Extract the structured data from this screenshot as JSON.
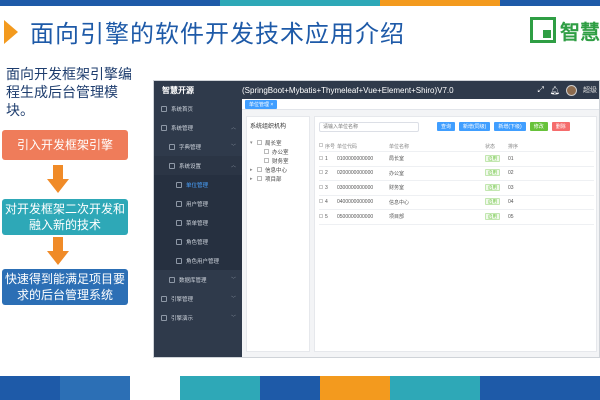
{
  "slide": {
    "title": "面向引擎的软件开发技术应用介绍",
    "logo_text": "智慧",
    "intro": "面向开发框架引擎编程生成后台管理模块。",
    "flow": [
      "引入开发框架引擎",
      "对开发框架二次开发和融入新的技术",
      "快速得到能满足项目要求的后台管理系统"
    ],
    "colors": {
      "title": "#1e5aa8",
      "accent_orange": "#f39a1e",
      "box1": "#ef7c5a",
      "box2": "#2ea8b7",
      "box3": "#2c6fb5",
      "logo_green": "#2f9e44"
    }
  },
  "app": {
    "brand": "智慧开源",
    "title": "(SpringBoot+Mybatis+Thymeleaf+Vue+Element+Shiro)V7.0",
    "header_icons": [
      "expand-icon",
      "bell-icon"
    ],
    "user_label": "超级",
    "sidebar": [
      {
        "label": "系统首页",
        "level": 1,
        "expandable": false
      },
      {
        "label": "系统管理",
        "level": 1,
        "expandable": true
      },
      {
        "label": "字典管理",
        "level": 2,
        "expandable": true
      },
      {
        "label": "系统设置",
        "level": 2,
        "expandable": true
      },
      {
        "label": "单位管理",
        "level": 3,
        "active": true
      },
      {
        "label": "用户管理",
        "level": 3
      },
      {
        "label": "菜单管理",
        "level": 3
      },
      {
        "label": "角色管理",
        "level": 3
      },
      {
        "label": "角色用户管理",
        "level": 3
      },
      {
        "label": "数据库管理",
        "level": 2,
        "expandable": true
      },
      {
        "label": "引擎管理",
        "level": 1,
        "expandable": true
      },
      {
        "label": "引擎演示",
        "level": 1,
        "expandable": true
      }
    ],
    "tab": "单位管理 ×",
    "tree": {
      "title": "系统组织机构",
      "nodes": [
        {
          "label": "局长室",
          "child": false,
          "toggle": "▾"
        },
        {
          "label": "办公室",
          "child": true
        },
        {
          "label": "财务室",
          "child": true
        },
        {
          "label": "信息中心",
          "child": false,
          "toggle": "▸"
        },
        {
          "label": "项目部",
          "child": false,
          "toggle": "▸"
        }
      ]
    },
    "toolbar": {
      "search_placeholder": "请输入单位名称",
      "search_btn": "查询",
      "add_same_btn": "新增(同级)",
      "add_sub_btn": "新增(下级)",
      "edit_btn": "修改",
      "delete_btn": "删除"
    },
    "table": {
      "headers": [
        "序号",
        "单位代码",
        "单位名称",
        "状态",
        "排序"
      ],
      "rows": [
        [
          "1",
          "0100000000000",
          "局长室",
          "启用",
          "01"
        ],
        [
          "2",
          "0200000000000",
          "办公室",
          "启用",
          "02"
        ],
        [
          "3",
          "0300000000000",
          "财务室",
          "启用",
          "03"
        ],
        [
          "4",
          "0400000000000",
          "信息中心",
          "启用",
          "04"
        ],
        [
          "5",
          "0500000000000",
          "项目部",
          "启用",
          "05"
        ]
      ]
    }
  }
}
